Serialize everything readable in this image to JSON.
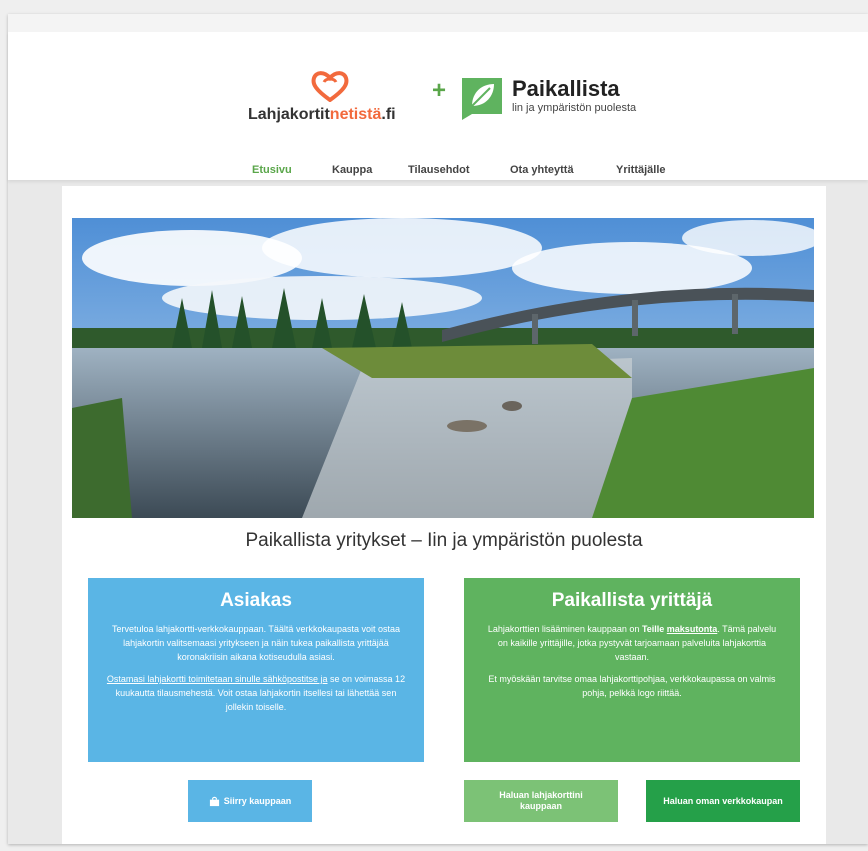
{
  "header": {
    "logo1_text": "Lahjakortit",
    "logo1_accent": "netistä",
    "logo1_suffix": ".fi",
    "plus": "+",
    "logo2_name": "Paikallista",
    "logo2_tagline": "lin ja ympäristön puolesta"
  },
  "nav": {
    "items": [
      {
        "label": "Etusivu",
        "active": true
      },
      {
        "label": "Kauppa"
      },
      {
        "label": "Tilausehdot"
      },
      {
        "label": "Ota yhteyttä"
      },
      {
        "label": "Yrittäjälle"
      }
    ]
  },
  "main": {
    "headline": "Paikallista yritykset – Iin ja ympäristön puolesta",
    "customer_card": {
      "title": "Asiakas",
      "p1": "Tervetuloa lahjakortti-verkkokauppaan. Täältä verkkokaupasta voit ostaa lahjakortin valitsemaasi yritykseen ja näin tukea paikallista yrittäjää koronakriisin aikana kotiseudulla asiasi.",
      "p2_link": "Ostamasi lahjakortti toimitetaan sinulle sähköpostitse ja",
      "p2_rest": "se on voimassa 12 kuukautta tilausmehestä. Voit ostaa lahjakortin itsellesi tai lähettää sen jollekin toiselle."
    },
    "entrepreneur_card": {
      "title": "Paikallista yrittäjä",
      "p1_start": "Lahjakorttien lisääminen kauppaan on",
      "p1_bold": "Teille",
      "p1_link": "maksutonta",
      "p1_rest": ". Tämä palvelu on kaikille yrittäjille, jotka pystyvät tarjoamaan palveluita lahjakorttia vastaan.",
      "p2": "Et myöskään tarvitse omaa lahjakorttipohjaa, verkkokaupassa on valmis pohja, pelkkä logo riittää."
    },
    "buttons": {
      "shop": "Siirry kauppaan",
      "gift_card": "Haluan lahjakorttini kauppaan",
      "web_shop": "Haluan oman verkkokaupan"
    }
  },
  "colors": {
    "accent_orange": "#f26a3d",
    "brand_green": "#5fb35f",
    "brand_blue": "#5ab5e5",
    "dark_green": "#25a049"
  }
}
